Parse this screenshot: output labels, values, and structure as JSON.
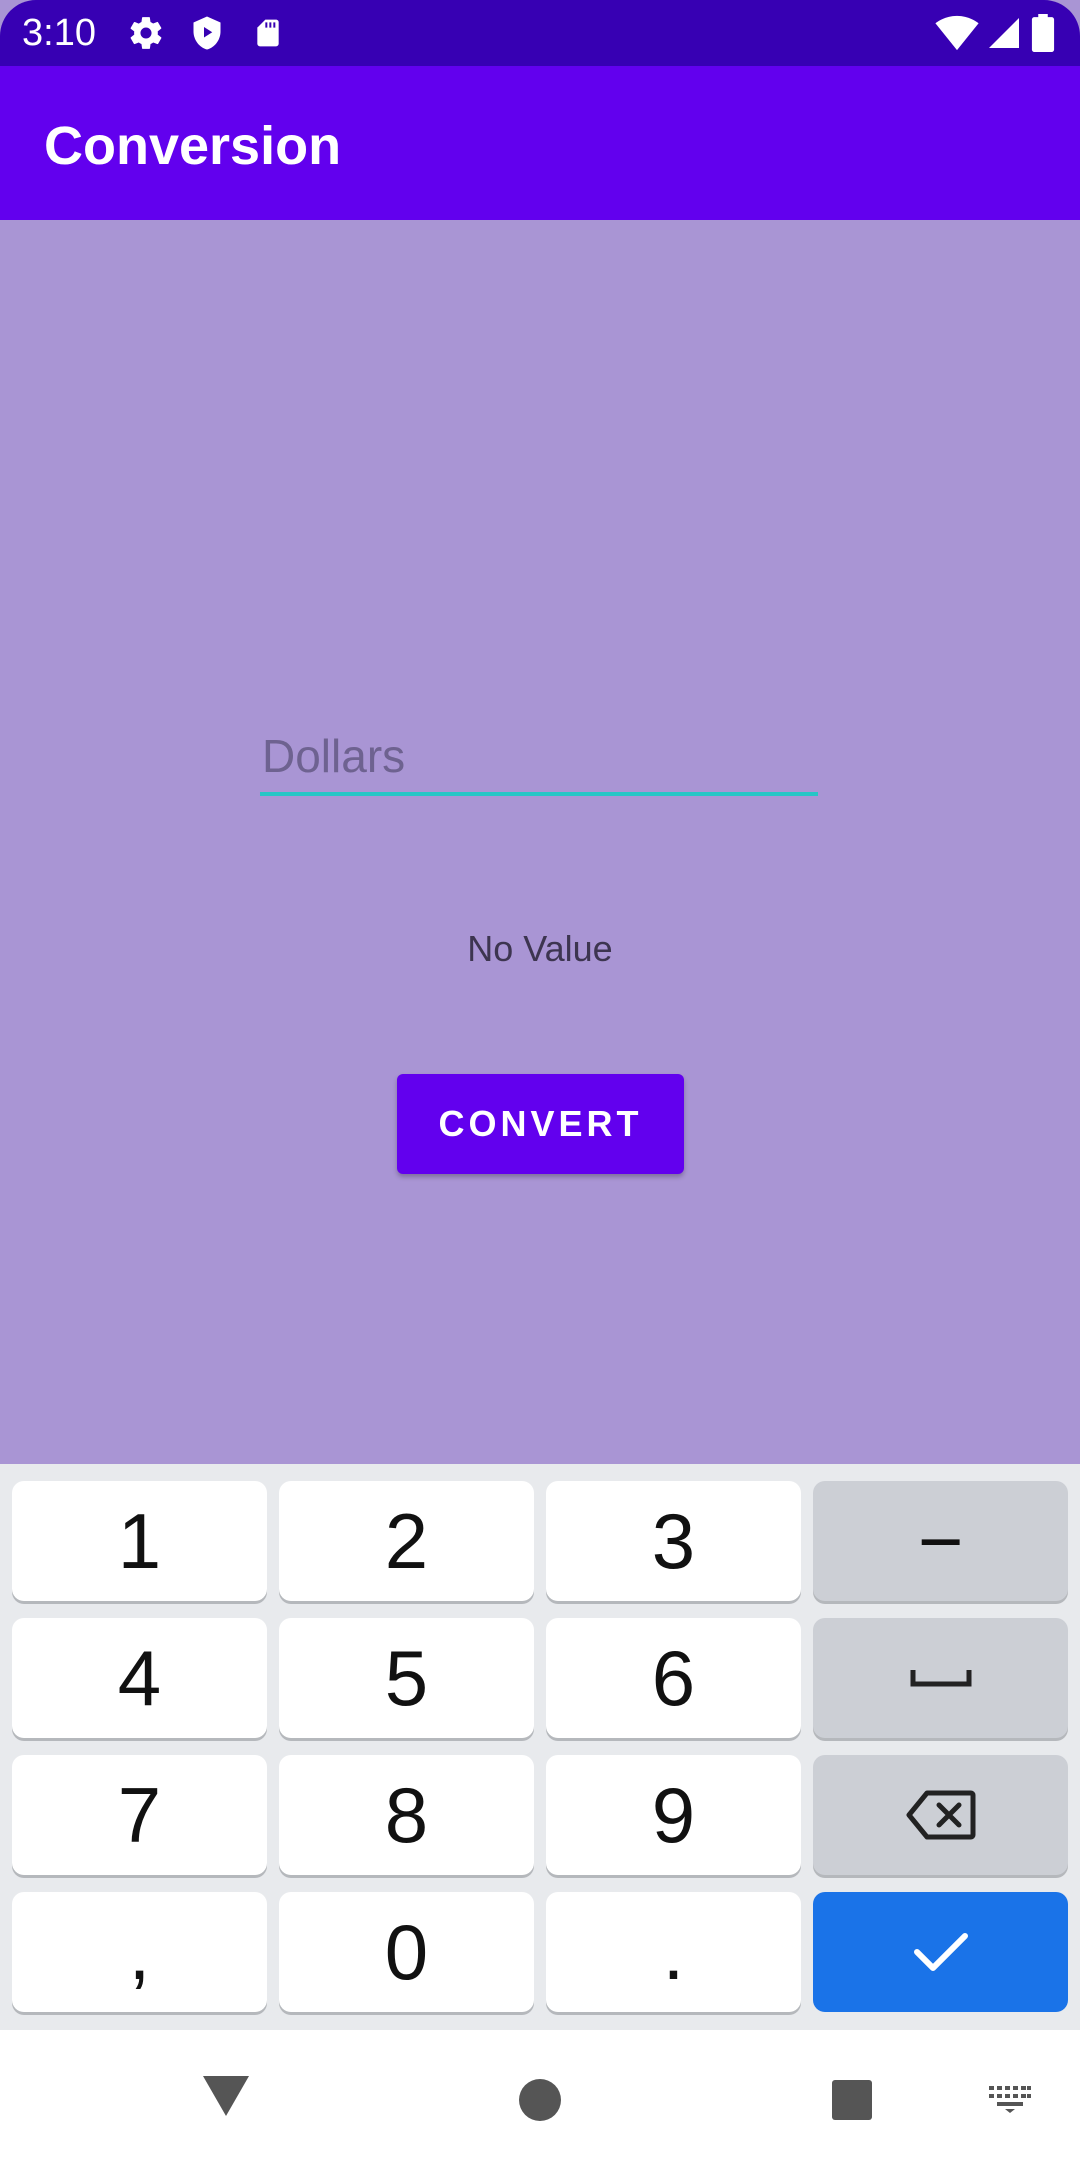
{
  "status_bar": {
    "time": "3:10",
    "left_icons": [
      "gear-icon",
      "shield-play-icon",
      "sd-card-icon"
    ],
    "right_icons": [
      "wifi-icon",
      "signal-icon",
      "battery-icon"
    ]
  },
  "app_bar": {
    "title": "Conversion"
  },
  "main": {
    "input_placeholder": "Dollars",
    "input_value": "",
    "result_text": "No Value",
    "convert_label": "CONVERT"
  },
  "keyboard": {
    "rows": [
      [
        "1",
        "2",
        "3",
        "−"
      ],
      [
        "4",
        "5",
        "6",
        "space-icon"
      ],
      [
        "7",
        "8",
        "9",
        "backspace-icon"
      ],
      [
        ",",
        "0",
        ".",
        "check-icon"
      ]
    ]
  },
  "nav": {
    "items": [
      "back-icon",
      "home-icon",
      "recents-icon",
      "keyboard-switch-icon"
    ]
  },
  "colors": {
    "status_bar": "#3700B3",
    "app_bar": "#6200EE",
    "background": "#A995D4",
    "input_underline": "#26C6C6",
    "done_key": "#1A73E8"
  }
}
